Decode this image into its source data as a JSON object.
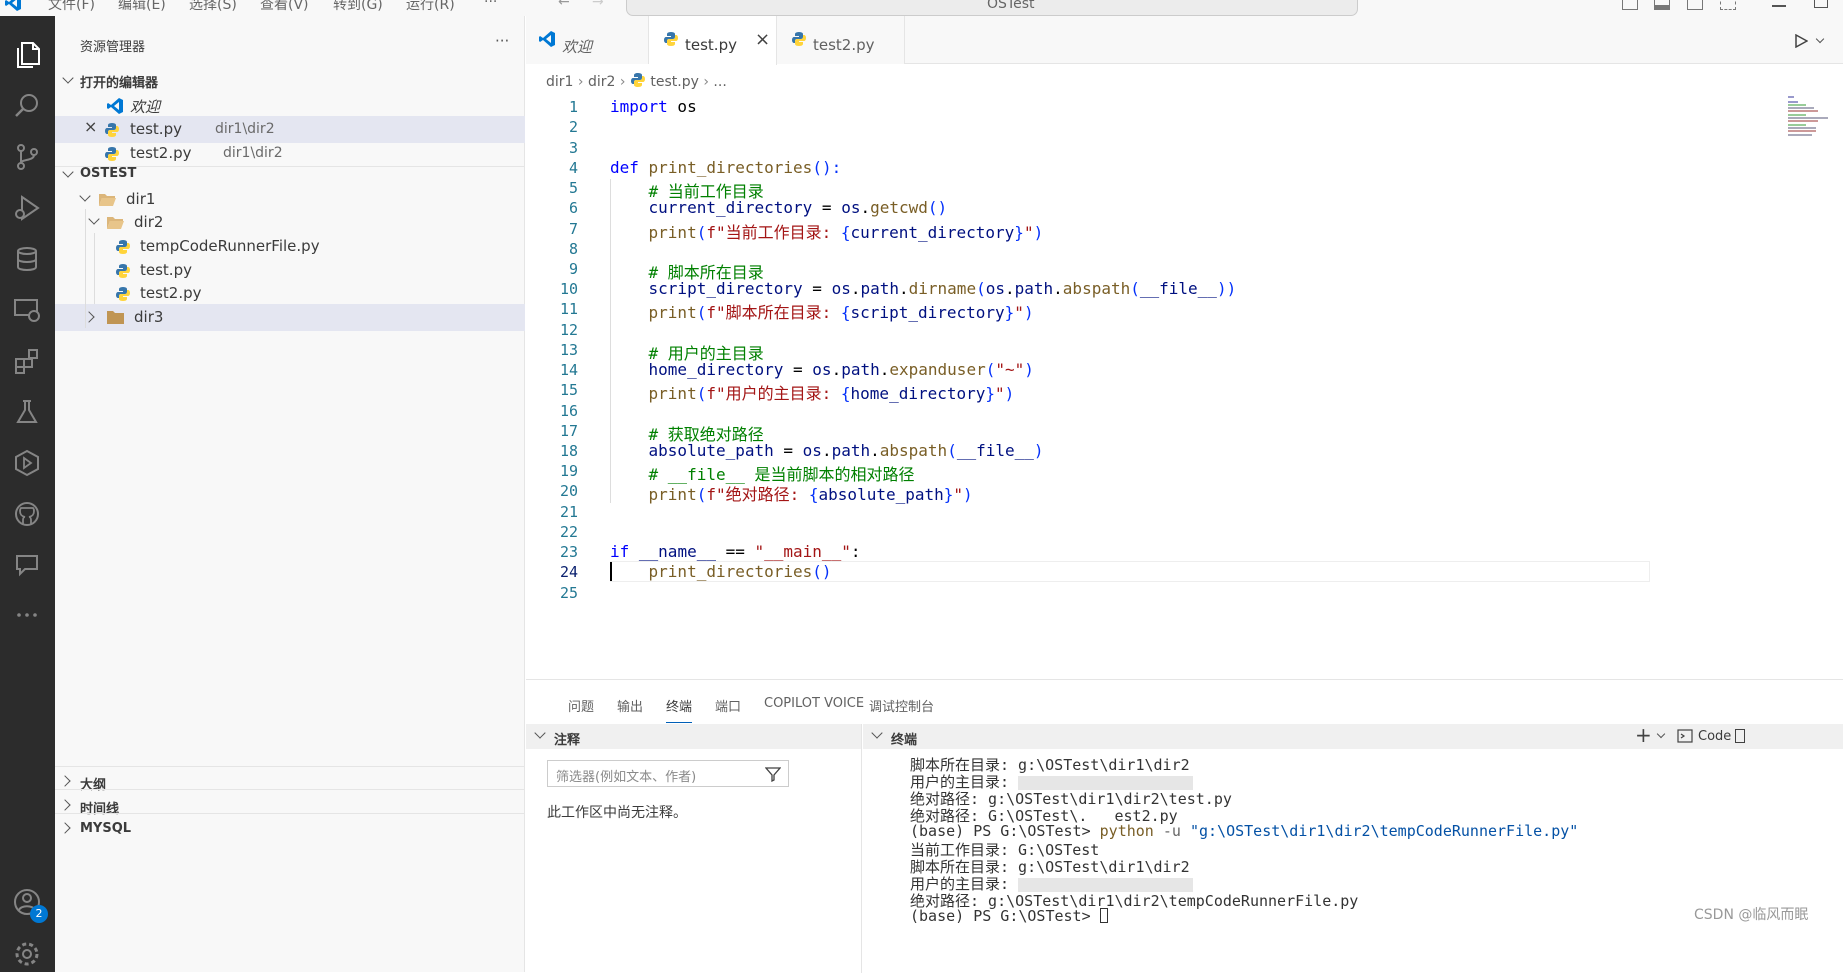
{
  "titlebar": {
    "menus": [
      "文件(F)",
      "编辑(E)",
      "选择(S)",
      "查看(V)",
      "转到(G)",
      "运行(R)",
      "···"
    ],
    "search": "OSTest"
  },
  "activity_icons": [
    "files-icon",
    "search-icon",
    "source-control-icon",
    "run-debug-icon",
    "database-icon",
    "remote-explorer-icon",
    "extensions-icon",
    "testing-icon",
    "deploy-icon",
    "github-icon",
    "comments-icon",
    "more-icon",
    "account-icon",
    "settings-icon"
  ],
  "account_badge": "2",
  "sidebar": {
    "title": "资源管理器",
    "more": "···",
    "open_editors": {
      "title": "打开的编辑器",
      "items": [
        {
          "name": "欢迎",
          "path": ""
        },
        {
          "name": "test.py",
          "path": "dir1\\dir2"
        },
        {
          "name": "test2.py",
          "path": "dir1\\dir2"
        }
      ]
    },
    "workspace": {
      "title": "OSTEST",
      "dir1": "dir1",
      "dir2": "dir2",
      "files": [
        "tempCodeRunnerFile.py",
        "test.py",
        "test2.py"
      ],
      "dir3": "dir3"
    },
    "bottom_sections": [
      "大纲",
      "时间线",
      "MYSQL"
    ]
  },
  "editor": {
    "tabs": [
      "欢迎",
      "test.py",
      "test2.py"
    ],
    "close": "×",
    "breadcrumb": {
      "a": "dir1",
      "b": "dir2",
      "c": "test.py",
      "d": "..."
    },
    "line_numbers": [
      "1",
      "2",
      "3",
      "4",
      "5",
      "6",
      "7",
      "8",
      "9",
      "10",
      "11",
      "12",
      "13",
      "14",
      "15",
      "16",
      "17",
      "18",
      "19",
      "20",
      "21",
      "22",
      "23",
      "24",
      "25"
    ],
    "code": {
      "l1": {
        "a": "import",
        "b": " os"
      },
      "l4": {
        "a": "def",
        "b": " ",
        "c": "print_directories",
        "d": "():"
      },
      "l5": "    # 当前工作目录",
      "l6": {
        "a": "    current_directory",
        "b": " = ",
        "c": "os",
        "d": ".",
        "e": "getcwd",
        "f": "()"
      },
      "l7": {
        "a": "    ",
        "b": "print",
        "c": "(",
        "d": "f\"当前工作目录: ",
        "e": "{",
        "f": "current_directory",
        "g": "}",
        "h": "\"",
        "i": ")"
      },
      "l9": "    # 脚本所在目录",
      "l10": {
        "a": "    script_directory",
        "b": " = ",
        "c": "os",
        "d": ".",
        "e": "path",
        "f": ".",
        "g": "dirname",
        "h": "(",
        "i": "os",
        "j": ".",
        "k": "path",
        "l": ".",
        "m": "abspath",
        "n": "(",
        "o": "__file__",
        "p": "))"
      },
      "l11": {
        "a": "    ",
        "b": "print",
        "c": "(",
        "d": "f\"脚本所在目录: ",
        "e": "{",
        "f": "script_directory",
        "g": "}",
        "h": "\"",
        "i": ")"
      },
      "l13": "    # 用户的主目录",
      "l14": {
        "a": "    home_directory",
        "b": " = ",
        "c": "os",
        "d": ".",
        "e": "path",
        "f": ".",
        "g": "expanduser",
        "h": "(",
        "i": "\"~\"",
        "j": ")"
      },
      "l15": {
        "a": "    ",
        "b": "print",
        "c": "(",
        "d": "f\"用户的主目录: ",
        "e": "{",
        "f": "home_directory",
        "g": "}",
        "h": "\"",
        "i": ")"
      },
      "l17": "    # 获取绝对路径",
      "l18": {
        "a": "    absolute_path",
        "b": " = ",
        "c": "os",
        "d": ".",
        "e": "path",
        "f": ".",
        "g": "abspath",
        "h": "(",
        "i": "__file__",
        "j": ")"
      },
      "l19": "    # __file__ 是当前脚本的相对路径",
      "l20": {
        "a": "    ",
        "b": "print",
        "c": "(",
        "d": "f\"绝对路径: ",
        "e": "{",
        "f": "absolute_path",
        "g": "}",
        "h": "\"",
        "i": ")"
      },
      "l23": {
        "a": "if",
        "b": " ",
        "c": "__name__",
        "d": " == ",
        "e": "\"__main__\"",
        "f": ":"
      },
      "l24": {
        "a": "    ",
        "b": "print_directories",
        "c": "()"
      }
    }
  },
  "panel": {
    "tabs": [
      "问题",
      "输出",
      "终端",
      "端口",
      "COPILOT VOICE",
      "调试控制台"
    ],
    "comments": {
      "title": "注释",
      "filter_placeholder": "筛选器(例如文本、作者)",
      "empty": "此工作区中尚无注释。"
    },
    "terminal": {
      "title": "终端",
      "add": "+",
      "profile": "Code",
      "lines": [
        "脚本所在目录: g:\\OSTest\\dir1\\dir2",
        "用户的主目录: ",
        "绝对路径: g:\\OSTest\\dir1\\dir2\\test.py",
        "绝对路径: G:\\OSTest\\.   est2.py",
        "(base) PS G:\\OSTest> ",
        "当前工作目录: G:\\OSTest",
        "脚本所在目录: g:\\OSTest\\dir1\\dir2",
        "用户的主目录: ",
        "绝对路径: g:\\OSTest\\dir1\\dir2\\tempCodeRunnerFile.py",
        "(base) PS G:\\OSTest> "
      ],
      "cmd_python": "python",
      "cmd_flag": " -u ",
      "cmd_path": "\"g:\\OSTest\\dir1\\dir2\\tempCodeRunnerFile.py\""
    }
  },
  "watermark": "CSDN @临风而眠"
}
